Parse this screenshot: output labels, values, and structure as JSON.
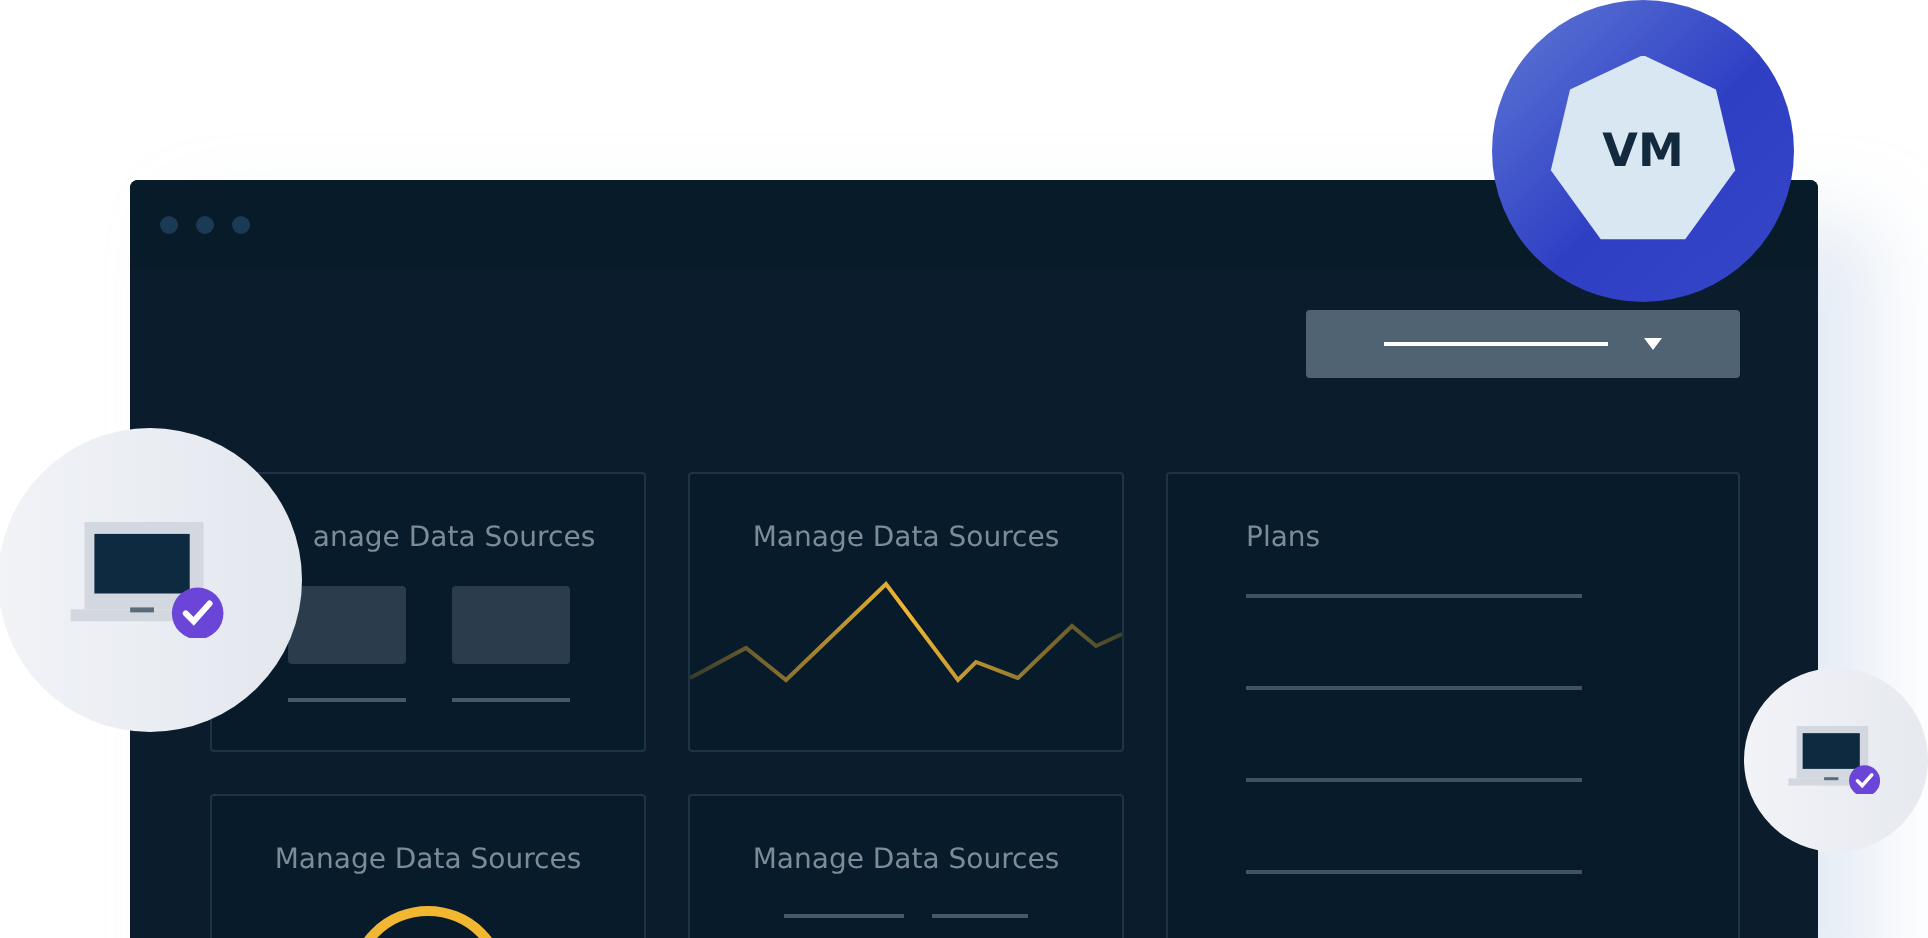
{
  "badge": {
    "label": "VM"
  },
  "cards": [
    {
      "kind": "tiles",
      "title": "anage Data Sources"
    },
    {
      "kind": "line",
      "title": "Manage Data Sources"
    },
    {
      "kind": "gauge",
      "title": "Manage Data Sources"
    },
    {
      "kind": "lines",
      "title": "Manage Data Sources"
    }
  ],
  "plans": {
    "title": "Plans"
  }
}
